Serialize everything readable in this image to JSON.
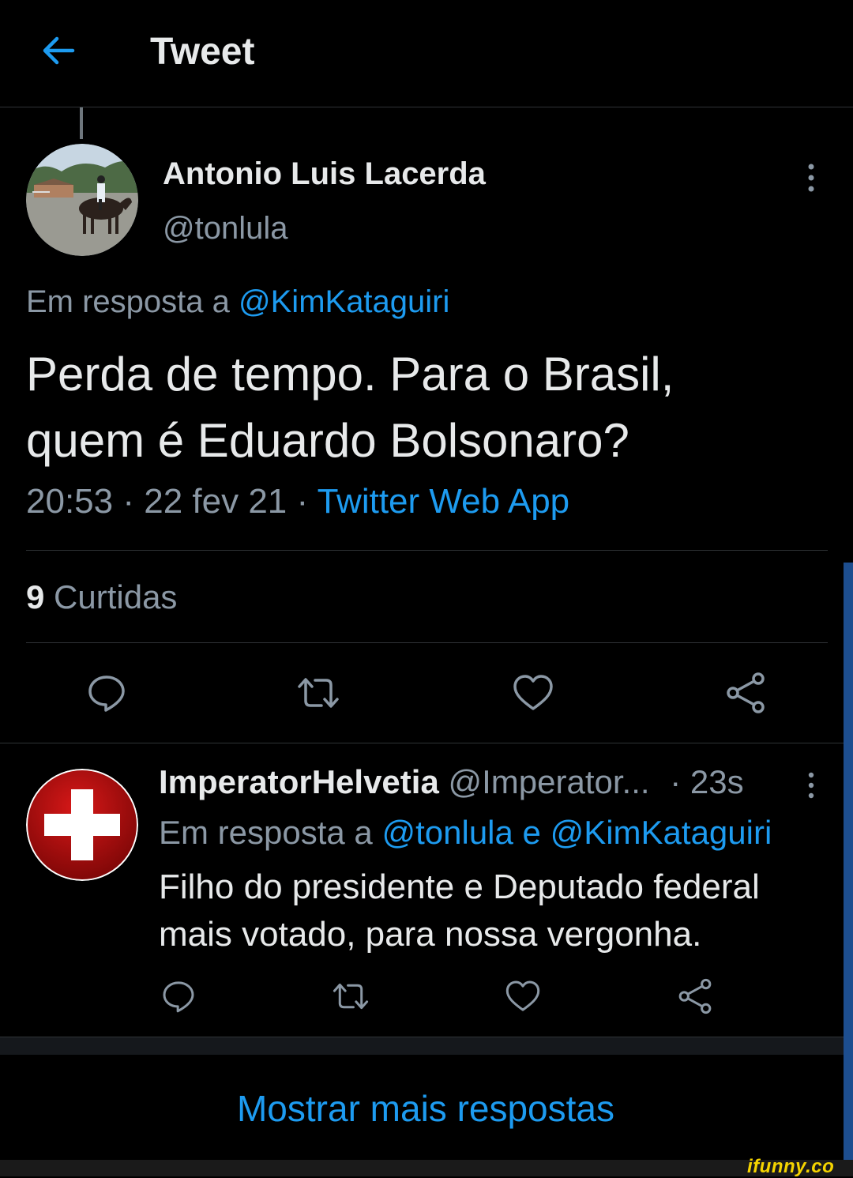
{
  "header": {
    "title": "Tweet",
    "back_icon": "arrow-left-icon"
  },
  "tweet": {
    "author_name": "Antonio Luis Lacerda",
    "author_handle": "@tonlula",
    "reply_prefix": "Em resposta a",
    "reply_mention": "@KimKataguiri",
    "text_line1": "Perda de tempo. Para o Brasil,",
    "text_line2": "quem é Eduardo Bolsonaro?",
    "time": "20:53",
    "date": "22 fev 21",
    "source": "Twitter Web App",
    "likes_count": "9",
    "likes_label": "Curtidas"
  },
  "reply": {
    "author_name": "ImperatorHelvetia",
    "author_handle": "@Imperator...",
    "age": "· 23s",
    "reply_prefix": "Em resposta a",
    "reply_mentions": "@tonlula e @KimKataguiri",
    "text_line1": "Filho do presidente e Deputado federal",
    "text_line2": "mais votado, para nossa vergonha."
  },
  "footer": {
    "show_more": "Mostrar mais respostas"
  },
  "watermark": "ifunny.co",
  "colors": {
    "accent": "#1d9bf0",
    "background": "#000000",
    "secondary_text": "#8b98a5"
  }
}
